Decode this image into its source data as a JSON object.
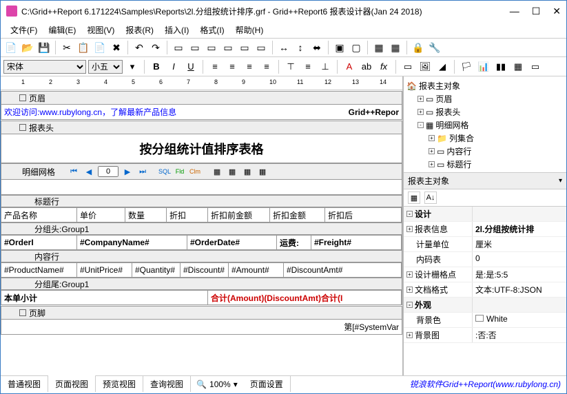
{
  "title": "C:\\Grid++Report 6.171224\\Samples\\Reports\\2l.分组按统计排序.grf - Grid++Report6 报表设计器(Jan 24 2018)",
  "menu": {
    "file": "文件(F)",
    "edit": "编辑(E)",
    "view": "视图(V)",
    "report": "报表(R)",
    "insert": "插入(I)",
    "format": "格式(I)",
    "help": "帮助(H)"
  },
  "font": {
    "name": "宋体",
    "size": "小五"
  },
  "sections": {
    "pageHeader": "页眉",
    "reportHeader": "报表头",
    "detailGrid": "明细网格",
    "titleRow": "标题行",
    "groupHeader": "分组头:Group1",
    "contentRow": "内容行",
    "groupFooter": "分组尾:Group1",
    "pageFooter": "页脚"
  },
  "welcome": {
    "prefix": "欢迎访问:",
    "url": "www.rubylong.cn",
    "suffix": "，了解最新产品信息"
  },
  "welcomeRight": "Grid++Repor",
  "bigTitle": "按分组统计值排序表格",
  "navValue": "0",
  "columns": [
    "产品名称",
    "单价",
    "数量",
    "折扣",
    "折扣前金额",
    "折扣金额",
    "折扣后"
  ],
  "groupHeaderFields": {
    "order": "#OrderI",
    "company": "#CompanyName#",
    "date": "#OrderDate#",
    "freightLabel": "运费:",
    "freight": "#Freight#"
  },
  "contentFields": [
    "#ProductName#",
    "#UnitPrice#",
    "#Quantity#",
    "#Discount#",
    "#Amount#",
    "#DiscountAmt#"
  ],
  "groupFooter": {
    "label": "本单小计",
    "sum": "合计(Amount)(DiscountAmt)合计(I"
  },
  "pageFooterField": "第[#SystemVar",
  "tree": {
    "root": "报表主对象",
    "items": [
      "页眉",
      "报表头",
      "明细网格"
    ],
    "sub": [
      "列集合",
      "内容行",
      "标题行"
    ]
  },
  "propHeader": "报表主对象",
  "props": {
    "catDesign": "设计",
    "reportInfo": {
      "k": "报表信息",
      "v": "2l.分组按统计排"
    },
    "unit": {
      "k": "计量单位",
      "v": "厘米"
    },
    "codepage": {
      "k": "内码表",
      "v": "0"
    },
    "gridpt": {
      "k": "设计栅格点",
      "v": "是:是:5:5"
    },
    "docfmt": {
      "k": "文档格式",
      "v": "文本:UTF-8:JSON"
    },
    "catAppear": "外观",
    "bgcolor": {
      "k": "背景色",
      "v": "White"
    },
    "bgimg": {
      "k": "背景图",
      "v": ":否:否"
    }
  },
  "tabs": [
    "普通视图",
    "页面视图",
    "预览视图",
    "查询视图"
  ],
  "zoom": "100%",
  "pageSetup": "页面设置",
  "footerLink": "锐浪软件Grid++Report(www.rubylong.cn)"
}
